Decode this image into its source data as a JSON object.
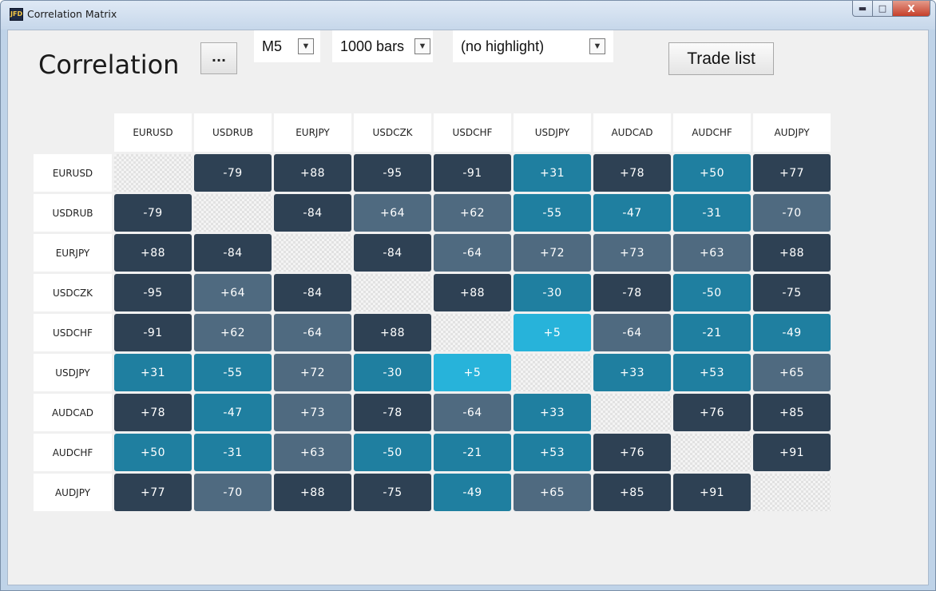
{
  "window": {
    "app_icon": "JFD",
    "title": "Correlation Matrix",
    "minimize_glyph": "▬",
    "maximize_glyph": "□",
    "close_glyph": "X"
  },
  "toolbar": {
    "heading": "Correlation",
    "more_label": "...",
    "timeframe": "M5",
    "bars": "1000 bars",
    "highlight": "(no highlight)",
    "dropdown_arrow": "▼",
    "trade_list_label": "Trade list"
  },
  "colors": {
    "strong": "#2e4154",
    "medium": "#4f6a80",
    "teal": "#1f7fa0",
    "light": "#27b3da"
  },
  "matrix": {
    "symbols": [
      "EURUSD",
      "USDRUB",
      "EURJPY",
      "USDCZK",
      "USDCHF",
      "USDJPY",
      "AUDCAD",
      "AUDCHF",
      "AUDJPY"
    ],
    "values": [
      [
        null,
        "-79",
        "+88",
        "-95",
        "-91",
        "+31",
        "+78",
        "+50",
        "+77"
      ],
      [
        "-79",
        null,
        "-84",
        "+64",
        "+62",
        "-55",
        "-47",
        "-31",
        "-70"
      ],
      [
        "+88",
        "-84",
        null,
        "-84",
        "-64",
        "+72",
        "+73",
        "+63",
        "+88"
      ],
      [
        "-95",
        "+64",
        "-84",
        null,
        "+88",
        "-30",
        "-78",
        "-50",
        "-75"
      ],
      [
        "-91",
        "+62",
        "-64",
        "+88",
        null,
        "+5",
        "-64",
        "-21",
        "-49"
      ],
      [
        "+31",
        "-55",
        "+72",
        "-30",
        "+5",
        null,
        "+33",
        "+53",
        "+65"
      ],
      [
        "+78",
        "-47",
        "+73",
        "-78",
        "-64",
        "+33",
        null,
        "+76",
        "+85"
      ],
      [
        "+50",
        "-31",
        "+63",
        "-50",
        "-21",
        "+53",
        "+76",
        null,
        "+91"
      ],
      [
        "+77",
        "-70",
        "+88",
        "-75",
        "-49",
        "+65",
        "+85",
        "+91",
        null
      ]
    ]
  }
}
